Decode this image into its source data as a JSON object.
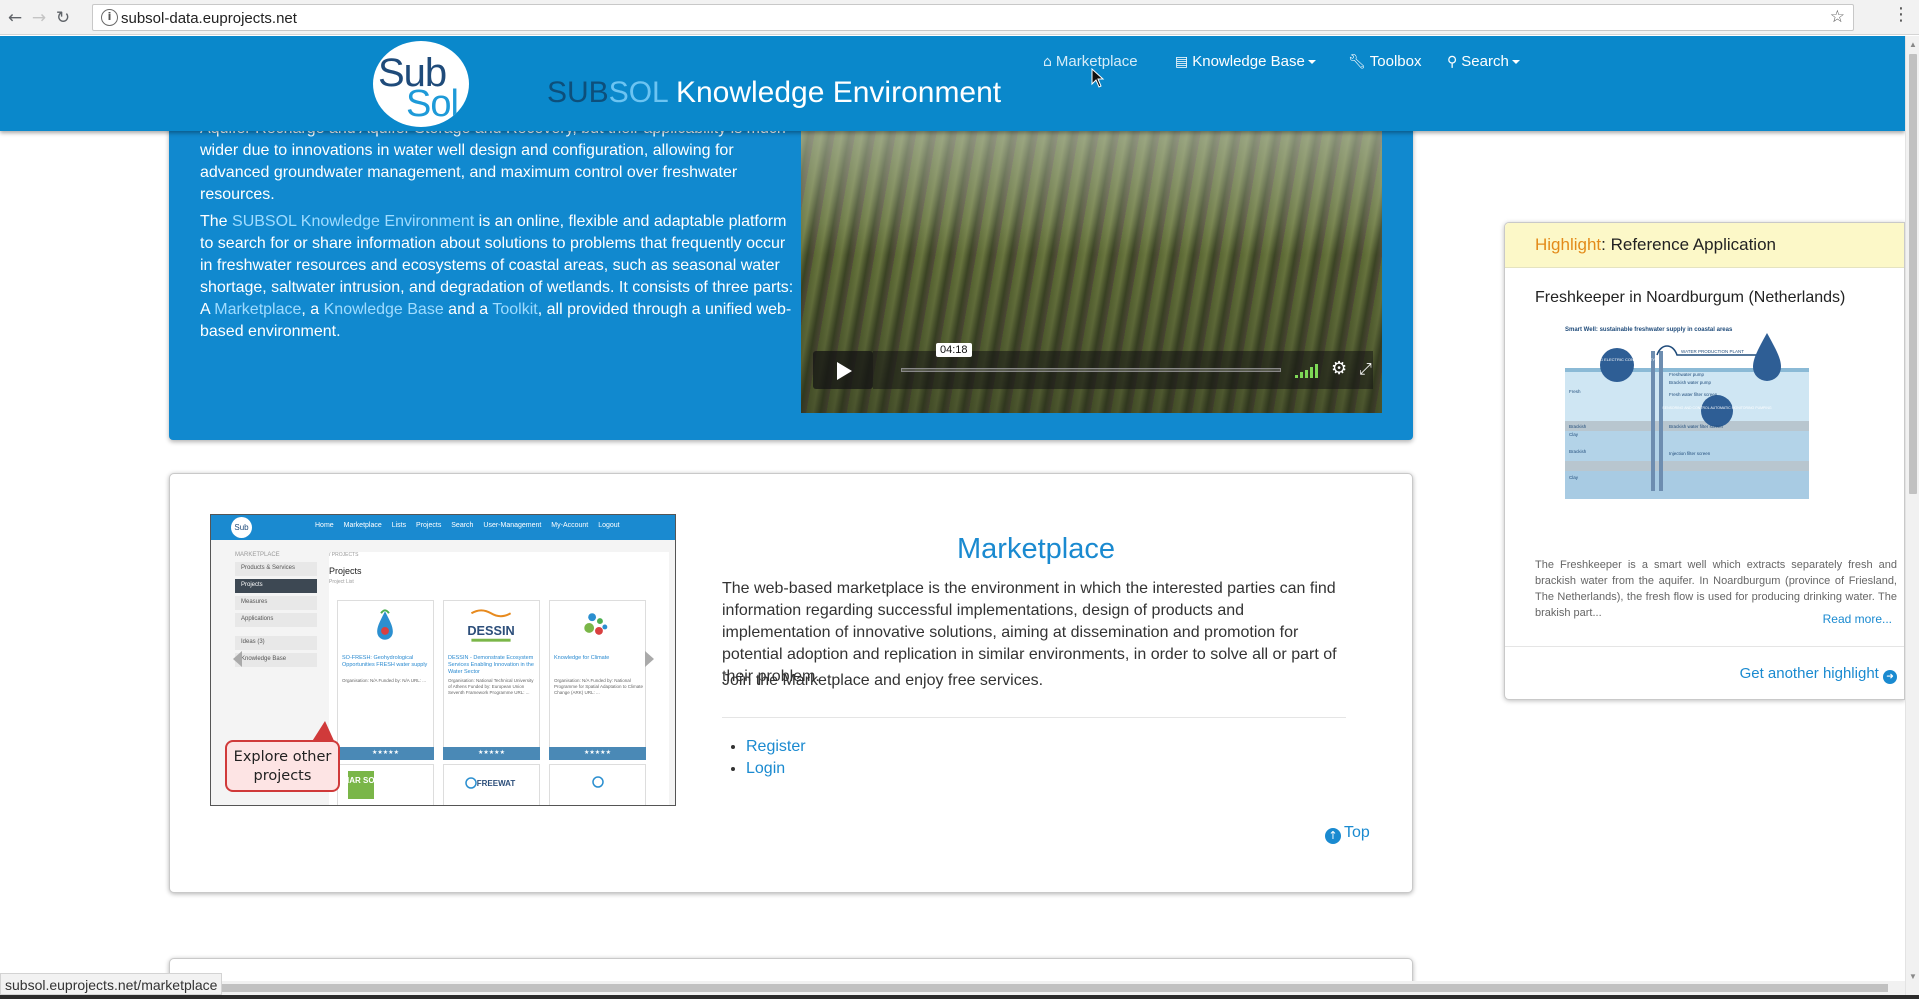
{
  "browser": {
    "url": "subsol-data.euprojects.net",
    "status_url": "subsol.euprojects.net/marketplace"
  },
  "header": {
    "logo_sub": "Sub",
    "logo_sol": "Sol",
    "brand_part1": "SUB",
    "brand_part2": "SOL",
    "brand_part3": " Knowledge Environment",
    "nav": {
      "marketplace": "Marketplace",
      "knowledge_base": "Knowledge Base",
      "toolbox": "Toolbox",
      "search": "Search"
    }
  },
  "intro": {
    "p1": "These subsurface water solutions (SWS) are built on experiences with Managed Aquifer Recharge and Aquifer Storage and Recovery, but their applicability is much wider due to innovations in water well design and configuration, allowing for advanced groundwater management, and maximum control over freshwater resources.",
    "p2_start": "The ",
    "p2_link": "SUBSOL Knowledge Environment",
    "p2_mid": " is an online, flexible and adaptable platform to search for or share information about solutions to problems that frequently occur in freshwater resources and ecosystems of coastal areas, such as seasonal water shortage, saltwater intrusion, and degradation of wetlands. It consists of three parts: A ",
    "p2_link_marketplace": "Marketplace",
    "p2_comma": ", a ",
    "p2_link_kb": "Knowledge Base",
    "p2_and": " and a ",
    "p2_link_toolkit": "Toolkit",
    "p2_end": ", all provided through a unified web-based environment.",
    "video_time": "04:18"
  },
  "marketplace": {
    "title": "Marketplace",
    "description": "The web-based marketplace is the environment in which the interested parties can find information regarding successful implementations, design of products and implementation of innovative solutions, aiming at dissemination and promotion for potential adoption and replication in similar environments, in order to solve all or part of their problem.",
    "join": "Join the Marketplace and enjoy free services.",
    "register": "Register",
    "login": "Login",
    "top": "Top",
    "screenshot": {
      "logo": "Sub",
      "nav": "Home Marketplace Lists Projects Search User-Management My-Account Logout",
      "side_label": "MARKETPLACE",
      "side_items": [
        "Products & Services",
        "Projects",
        "Measures",
        "Applications",
        "Ideas (3)",
        "Knowledge Base"
      ],
      "crumb": "/ PROJECTS",
      "page_title": "Projects",
      "page_sub": "Project List",
      "cards": [
        {
          "title": "SO-FRESH: Geohydrological Opportunities FRESH water supply",
          "meta": "Organisation: N/A Funded by: N/A URL: ..."
        },
        {
          "title": "DESSIN - Demonstrate Ecosystem Services Enabling Innovation in the Water Sector",
          "meta": "Organisation: National Technical University of Athens Funded by: European Union Seventh Framework Programme URL: ..."
        },
        {
          "title": "Knowledge for Climate",
          "meta": "Organisation: N/A Funded by: National Programme for Spatial Adaptation to Climate Change (ARK) URL: ..."
        }
      ],
      "dessin_logo": "DESSIN",
      "mar_logo": "MAR SOL",
      "freewat_logo": "FREEWAT",
      "stars": "★★★★★",
      "bubble": "Explore other projects"
    }
  },
  "highlight": {
    "prefix": "Highlight",
    "heading": ": Reference Application",
    "subtitle": "Freshkeeper in Noardburgum (Netherlands)",
    "diagram_title": "Smart Well: sustainable freshwater supply in coastal areas",
    "diagram_labels": {
      "plant": "WATER PRODUCTION PLANT",
      "sensor": "SENSORING ELECTRIC CONDUCTIVITY",
      "fresh_pump": "Freshwater pump",
      "brack_pump": "Brackish water pump",
      "fresh_screen": "Fresh water filter screen",
      "brack_screen": "Brackish water filter screen",
      "inject": "Injection filter screen",
      "fresh": "Fresh",
      "brackish": "Brackish",
      "clay": "Clay",
      "brackish2": "Brackish",
      "clay2": "Clay",
      "sensor2": "SENSORING AND CONTROL AUTOMATIC MONITORING PUMPING"
    },
    "description": "The Freshkeeper is a smart well which extracts separately fresh and brackish water from the aquifer. In Noardburgum (province of Friesland, The Netherlands), the fresh flow is used for producing drinking water. The brakish part...",
    "read_more": "Read more...",
    "another": "Get another highlight",
    "accent_color": "#e38b1a"
  },
  "icons": {
    "back": "back-arrow-icon",
    "forward": "forward-arrow-icon",
    "reload": "reload-icon",
    "info": "info-icon",
    "star": "bookmark-star-icon",
    "menu": "kebab-menu-icon",
    "home": "home-icon",
    "table": "table-icon",
    "wrench": "wrench-icon",
    "search": "search-icon",
    "play": "play-icon",
    "gear": "gear-icon",
    "fullscreen": "fullscreen-icon",
    "arrow_up": "arrow-circle-up-icon",
    "arrow_right": "arrow-circle-right-icon"
  },
  "colors": {
    "header_bg": "#0a88cb",
    "intro_bg": "#1189cf",
    "link": "#1a8ad0",
    "highlight_bg": "#fcf8c8"
  }
}
